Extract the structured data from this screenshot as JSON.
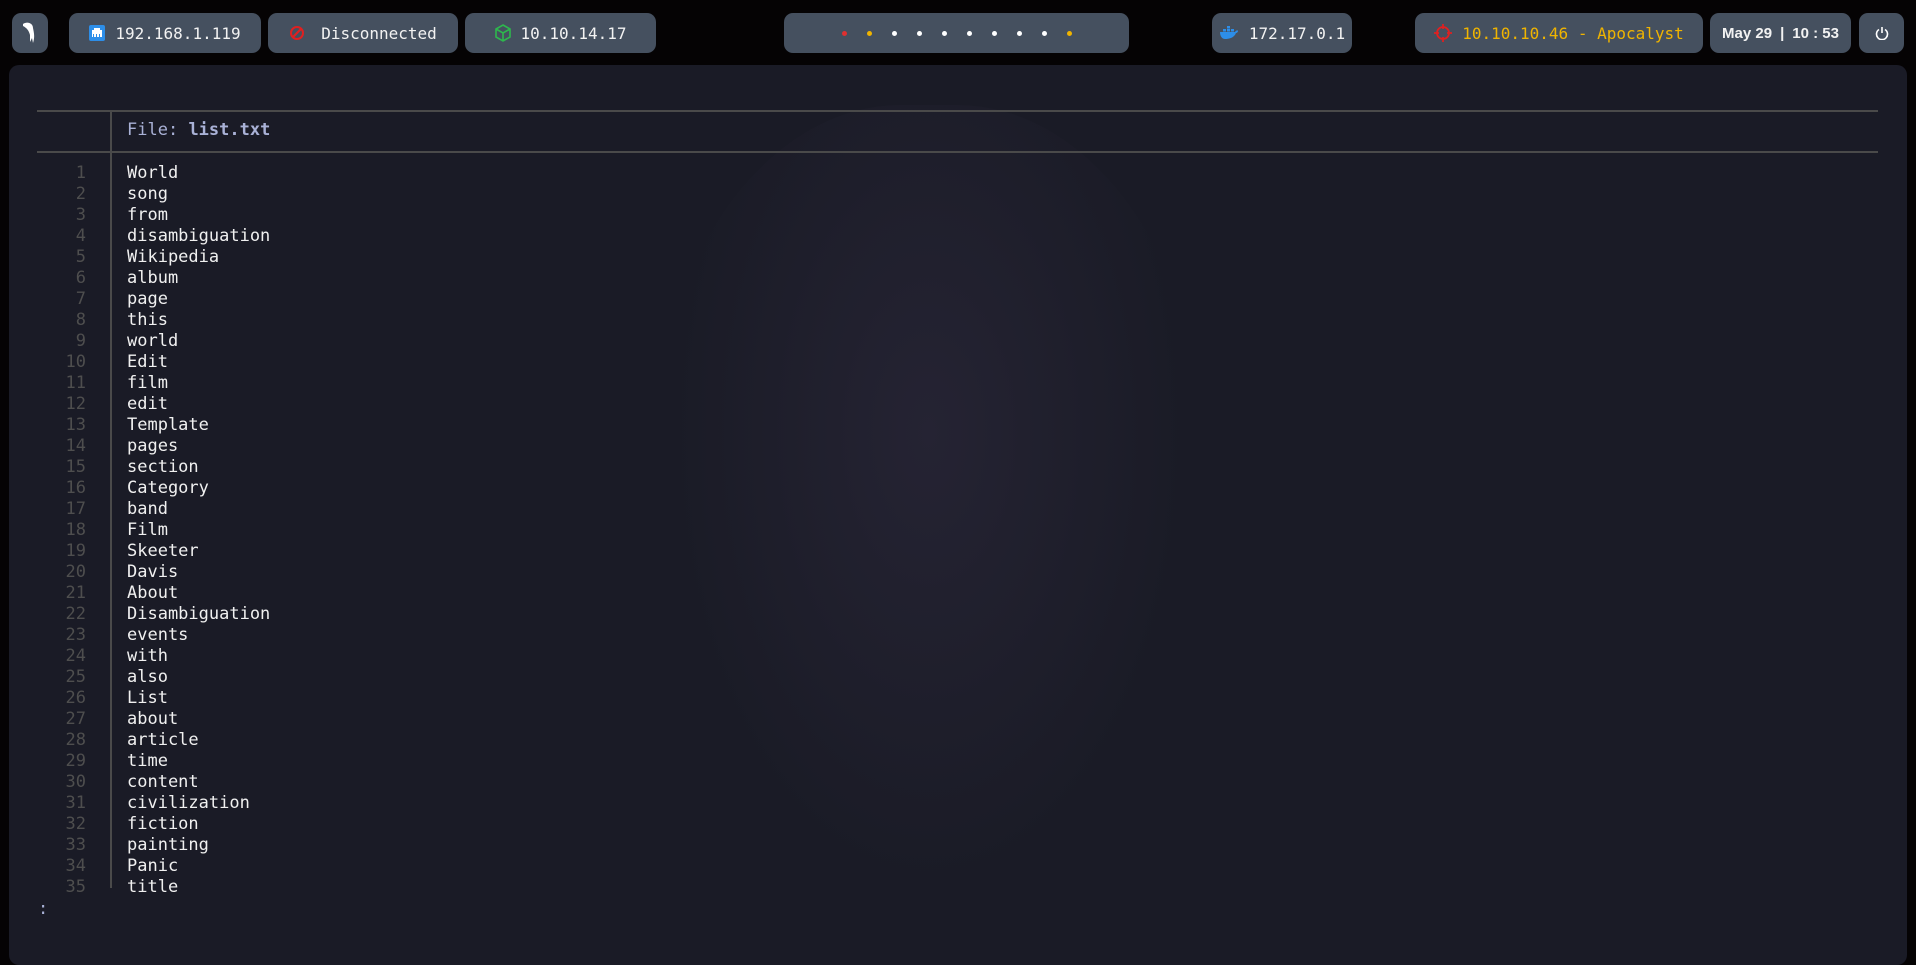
{
  "topbar": {
    "menu_icon": "parrot-icon",
    "local_ip": "192.168.1.119",
    "vpn_status": "Disconnected",
    "vpn_ip": "10.10.14.17",
    "workspaces": [
      {
        "color": "#e03030"
      },
      {
        "color": "#f0b400"
      },
      {
        "color": "#ffffff"
      },
      {
        "color": "#ffffff"
      },
      {
        "color": "#ffffff"
      },
      {
        "color": "#ffffff"
      },
      {
        "color": "#ffffff"
      },
      {
        "color": "#ffffff"
      },
      {
        "color": "#ffffff"
      },
      {
        "color": "#f0b400"
      }
    ],
    "docker_ip": "172.17.0.1",
    "target": "10.10.10.46 - Apocalyst",
    "date": "May 29",
    "separator": "|",
    "time": "10 : 53"
  },
  "colors": {
    "ethernet": "#2d8ee8",
    "disconnected": "#e02020",
    "vpn": "#2db84d",
    "target": "#f0b400",
    "target_icon": "#e02020"
  },
  "viewer": {
    "file_label": "File:",
    "file_name": "list.txt",
    "lines": [
      "World",
      "song",
      "from",
      "disambiguation",
      "Wikipedia",
      "album",
      "page",
      "this",
      "world",
      "Edit",
      "film",
      "edit",
      "Template",
      "pages",
      "section",
      "Category",
      "band",
      "Film",
      "Skeeter",
      "Davis",
      "About",
      "Disambiguation",
      "events",
      "with",
      "also",
      "List",
      "about",
      "article",
      "time",
      "content",
      "civilization",
      "fiction",
      "painting",
      "Panic",
      "title"
    ],
    "prompt": ":"
  }
}
